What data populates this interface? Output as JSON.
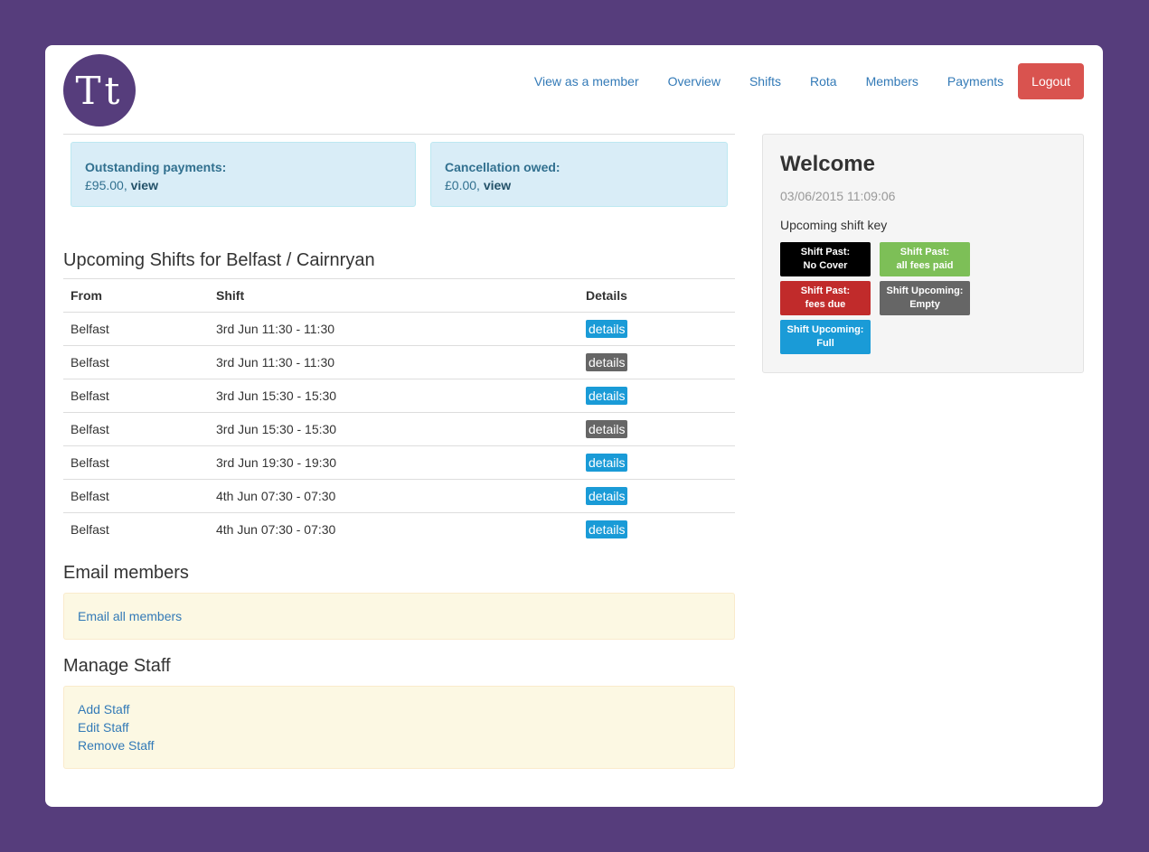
{
  "logo": {
    "text": "Tt"
  },
  "nav": {
    "items": [
      {
        "label": "View as a member"
      },
      {
        "label": "Overview"
      },
      {
        "label": "Shifts"
      },
      {
        "label": "Rota"
      },
      {
        "label": "Members"
      },
      {
        "label": "Payments"
      }
    ],
    "logout_label": "Logout"
  },
  "alerts": {
    "outstanding": {
      "label": "Outstanding payments:",
      "amount": "£95.00, ",
      "link": "view"
    },
    "cancellation": {
      "label": "Cancellation owed:",
      "amount": "£0.00, ",
      "link": "view"
    }
  },
  "shifts": {
    "title": "Upcoming Shifts for Belfast / Cairnryan",
    "columns": [
      "From",
      "Shift",
      "Details"
    ],
    "rows": [
      {
        "from": "Belfast",
        "shift": "3rd Jun 11:30 - 11:30",
        "details": "details",
        "color": "#1a9bd7"
      },
      {
        "from": "Belfast",
        "shift": "3rd Jun 11:30 - 11:30",
        "details": "details",
        "color": "#666666"
      },
      {
        "from": "Belfast",
        "shift": "3rd Jun 15:30 - 15:30",
        "details": "details",
        "color": "#1a9bd7"
      },
      {
        "from": "Belfast",
        "shift": "3rd Jun 15:30 - 15:30",
        "details": "details",
        "color": "#666666"
      },
      {
        "from": "Belfast",
        "shift": "3rd Jun 19:30 - 19:30",
        "details": "details",
        "color": "#1a9bd7"
      },
      {
        "from": "Belfast",
        "shift": "4th Jun 07:30 - 07:30",
        "details": "details",
        "color": "#1a9bd7"
      },
      {
        "from": "Belfast",
        "shift": "4th Jun 07:30 - 07:30",
        "details": "details",
        "color": "#1a9bd7"
      }
    ]
  },
  "email": {
    "title": "Email members",
    "link": "Email all members"
  },
  "staff": {
    "title": "Manage Staff",
    "links": [
      "Add Staff",
      "Edit Staff",
      "Remove Staff"
    ]
  },
  "sidebar": {
    "title": "Welcome",
    "timestamp": "03/06/2015 11:09:06",
    "key_label": "Upcoming shift key",
    "keys": [
      {
        "line1": "Shift Past:",
        "line2": "No Cover",
        "color": "#000000"
      },
      {
        "line1": "Shift Past:",
        "line2": "all fees paid",
        "color": "#7dbf57"
      },
      {
        "line1": "Shift Past:",
        "line2": "fees due",
        "color": "#c12b2b"
      },
      {
        "line1": "Shift Upcoming:",
        "line2": "Empty",
        "color": "#666666"
      },
      {
        "line1": "Shift Upcoming:",
        "line2": "Full",
        "color": "#1a9bd7"
      }
    ]
  }
}
